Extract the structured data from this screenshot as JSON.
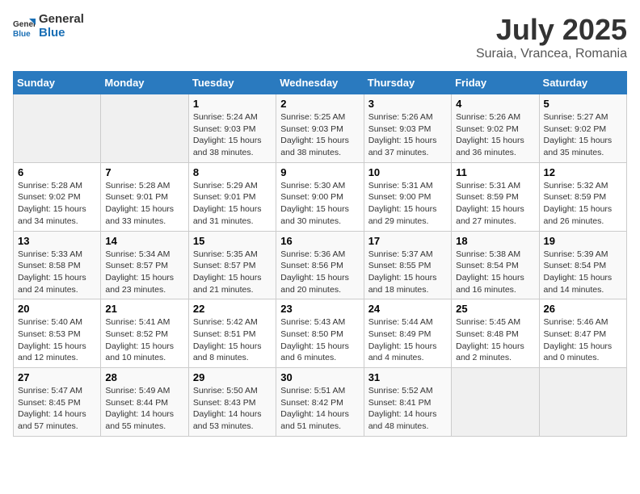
{
  "header": {
    "logo_line1": "General",
    "logo_line2": "Blue",
    "title": "July 2025",
    "subtitle": "Suraia, Vrancea, Romania"
  },
  "weekdays": [
    "Sunday",
    "Monday",
    "Tuesday",
    "Wednesday",
    "Thursday",
    "Friday",
    "Saturday"
  ],
  "weeks": [
    [
      {
        "day": "",
        "sunrise": "",
        "sunset": "",
        "daylight": ""
      },
      {
        "day": "",
        "sunrise": "",
        "sunset": "",
        "daylight": ""
      },
      {
        "day": "1",
        "sunrise": "Sunrise: 5:24 AM",
        "sunset": "Sunset: 9:03 PM",
        "daylight": "Daylight: 15 hours and 38 minutes."
      },
      {
        "day": "2",
        "sunrise": "Sunrise: 5:25 AM",
        "sunset": "Sunset: 9:03 PM",
        "daylight": "Daylight: 15 hours and 38 minutes."
      },
      {
        "day": "3",
        "sunrise": "Sunrise: 5:26 AM",
        "sunset": "Sunset: 9:03 PM",
        "daylight": "Daylight: 15 hours and 37 minutes."
      },
      {
        "day": "4",
        "sunrise": "Sunrise: 5:26 AM",
        "sunset": "Sunset: 9:02 PM",
        "daylight": "Daylight: 15 hours and 36 minutes."
      },
      {
        "day": "5",
        "sunrise": "Sunrise: 5:27 AM",
        "sunset": "Sunset: 9:02 PM",
        "daylight": "Daylight: 15 hours and 35 minutes."
      }
    ],
    [
      {
        "day": "6",
        "sunrise": "Sunrise: 5:28 AM",
        "sunset": "Sunset: 9:02 PM",
        "daylight": "Daylight: 15 hours and 34 minutes."
      },
      {
        "day": "7",
        "sunrise": "Sunrise: 5:28 AM",
        "sunset": "Sunset: 9:01 PM",
        "daylight": "Daylight: 15 hours and 33 minutes."
      },
      {
        "day": "8",
        "sunrise": "Sunrise: 5:29 AM",
        "sunset": "Sunset: 9:01 PM",
        "daylight": "Daylight: 15 hours and 31 minutes."
      },
      {
        "day": "9",
        "sunrise": "Sunrise: 5:30 AM",
        "sunset": "Sunset: 9:00 PM",
        "daylight": "Daylight: 15 hours and 30 minutes."
      },
      {
        "day": "10",
        "sunrise": "Sunrise: 5:31 AM",
        "sunset": "Sunset: 9:00 PM",
        "daylight": "Daylight: 15 hours and 29 minutes."
      },
      {
        "day": "11",
        "sunrise": "Sunrise: 5:31 AM",
        "sunset": "Sunset: 8:59 PM",
        "daylight": "Daylight: 15 hours and 27 minutes."
      },
      {
        "day": "12",
        "sunrise": "Sunrise: 5:32 AM",
        "sunset": "Sunset: 8:59 PM",
        "daylight": "Daylight: 15 hours and 26 minutes."
      }
    ],
    [
      {
        "day": "13",
        "sunrise": "Sunrise: 5:33 AM",
        "sunset": "Sunset: 8:58 PM",
        "daylight": "Daylight: 15 hours and 24 minutes."
      },
      {
        "day": "14",
        "sunrise": "Sunrise: 5:34 AM",
        "sunset": "Sunset: 8:57 PM",
        "daylight": "Daylight: 15 hours and 23 minutes."
      },
      {
        "day": "15",
        "sunrise": "Sunrise: 5:35 AM",
        "sunset": "Sunset: 8:57 PM",
        "daylight": "Daylight: 15 hours and 21 minutes."
      },
      {
        "day": "16",
        "sunrise": "Sunrise: 5:36 AM",
        "sunset": "Sunset: 8:56 PM",
        "daylight": "Daylight: 15 hours and 20 minutes."
      },
      {
        "day": "17",
        "sunrise": "Sunrise: 5:37 AM",
        "sunset": "Sunset: 8:55 PM",
        "daylight": "Daylight: 15 hours and 18 minutes."
      },
      {
        "day": "18",
        "sunrise": "Sunrise: 5:38 AM",
        "sunset": "Sunset: 8:54 PM",
        "daylight": "Daylight: 15 hours and 16 minutes."
      },
      {
        "day": "19",
        "sunrise": "Sunrise: 5:39 AM",
        "sunset": "Sunset: 8:54 PM",
        "daylight": "Daylight: 15 hours and 14 minutes."
      }
    ],
    [
      {
        "day": "20",
        "sunrise": "Sunrise: 5:40 AM",
        "sunset": "Sunset: 8:53 PM",
        "daylight": "Daylight: 15 hours and 12 minutes."
      },
      {
        "day": "21",
        "sunrise": "Sunrise: 5:41 AM",
        "sunset": "Sunset: 8:52 PM",
        "daylight": "Daylight: 15 hours and 10 minutes."
      },
      {
        "day": "22",
        "sunrise": "Sunrise: 5:42 AM",
        "sunset": "Sunset: 8:51 PM",
        "daylight": "Daylight: 15 hours and 8 minutes."
      },
      {
        "day": "23",
        "sunrise": "Sunrise: 5:43 AM",
        "sunset": "Sunset: 8:50 PM",
        "daylight": "Daylight: 15 hours and 6 minutes."
      },
      {
        "day": "24",
        "sunrise": "Sunrise: 5:44 AM",
        "sunset": "Sunset: 8:49 PM",
        "daylight": "Daylight: 15 hours and 4 minutes."
      },
      {
        "day": "25",
        "sunrise": "Sunrise: 5:45 AM",
        "sunset": "Sunset: 8:48 PM",
        "daylight": "Daylight: 15 hours and 2 minutes."
      },
      {
        "day": "26",
        "sunrise": "Sunrise: 5:46 AM",
        "sunset": "Sunset: 8:47 PM",
        "daylight": "Daylight: 15 hours and 0 minutes."
      }
    ],
    [
      {
        "day": "27",
        "sunrise": "Sunrise: 5:47 AM",
        "sunset": "Sunset: 8:45 PM",
        "daylight": "Daylight: 14 hours and 57 minutes."
      },
      {
        "day": "28",
        "sunrise": "Sunrise: 5:49 AM",
        "sunset": "Sunset: 8:44 PM",
        "daylight": "Daylight: 14 hours and 55 minutes."
      },
      {
        "day": "29",
        "sunrise": "Sunrise: 5:50 AM",
        "sunset": "Sunset: 8:43 PM",
        "daylight": "Daylight: 14 hours and 53 minutes."
      },
      {
        "day": "30",
        "sunrise": "Sunrise: 5:51 AM",
        "sunset": "Sunset: 8:42 PM",
        "daylight": "Daylight: 14 hours and 51 minutes."
      },
      {
        "day": "31",
        "sunrise": "Sunrise: 5:52 AM",
        "sunset": "Sunset: 8:41 PM",
        "daylight": "Daylight: 14 hours and 48 minutes."
      },
      {
        "day": "",
        "sunrise": "",
        "sunset": "",
        "daylight": ""
      },
      {
        "day": "",
        "sunrise": "",
        "sunset": "",
        "daylight": ""
      }
    ]
  ]
}
